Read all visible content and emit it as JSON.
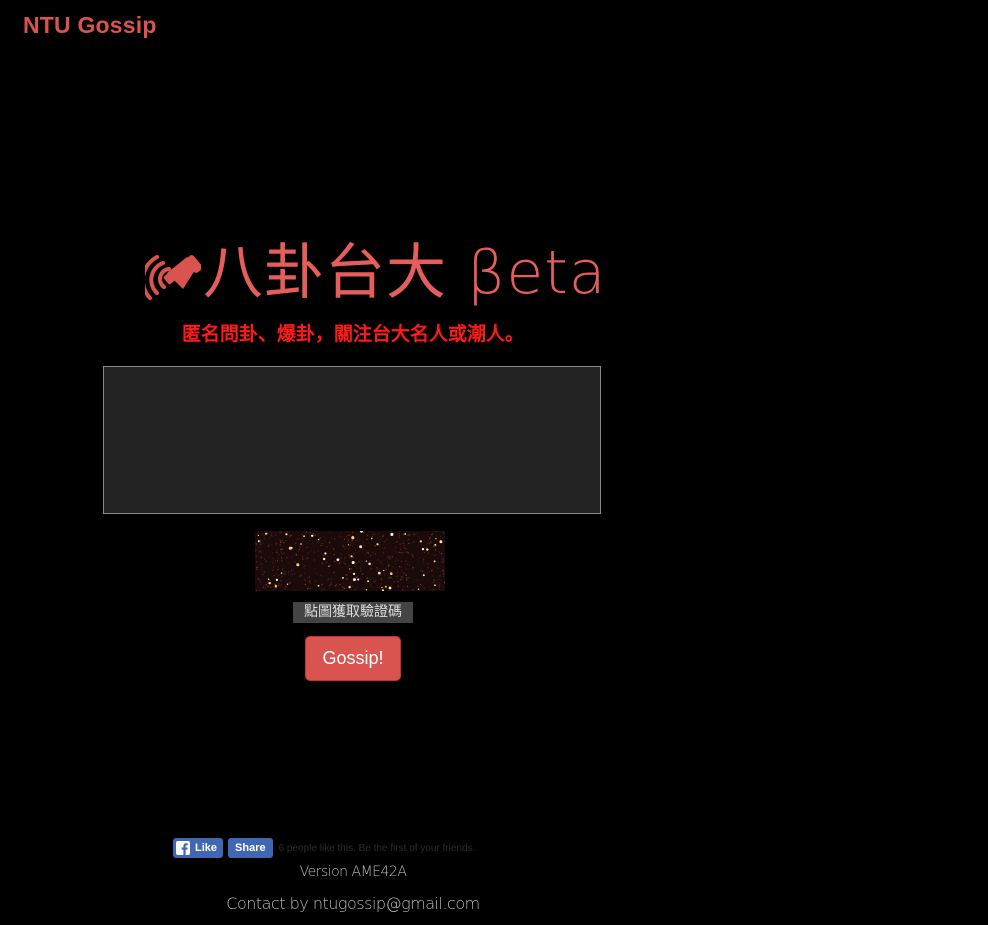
{
  "nav": {
    "brand": "NTU Gossip"
  },
  "hero": {
    "logo_icon": "megaphone-icon",
    "title": "八卦台大 βeta",
    "subtitle": "匿名問卦、爆卦，關注台大名人或潮人。"
  },
  "form": {
    "gossip_text": "",
    "gossip_placeholder": "",
    "captcha_button_label": "點圖獲取驗證碼",
    "submit_label": "Gossip!"
  },
  "social": {
    "like_label": "Like",
    "share_label": "Share",
    "like_text": "6 people like this. Be the first of your friends.",
    "fb_icon": "facebook-icon"
  },
  "footer": {
    "version": "Version AME42A",
    "contact_prefix": "Contact by",
    "contact_email": "ntugossip@gmail.com"
  },
  "colors": {
    "background": "#000000",
    "brand": "#d9534f",
    "title": "#e55e5a",
    "subtitle": "#ff1a1a",
    "textarea_bg": "#222222",
    "facebook": "#4267b2"
  }
}
